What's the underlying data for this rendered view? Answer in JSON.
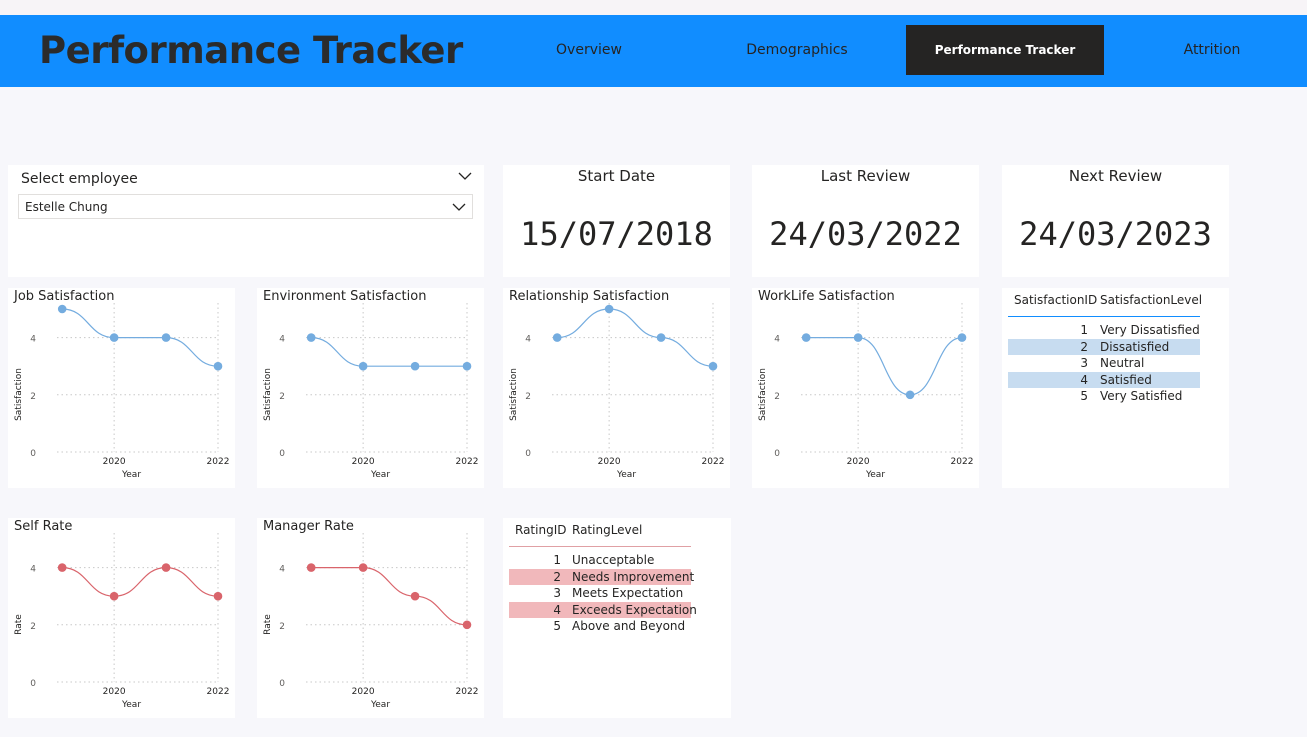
{
  "header": {
    "title": "Performance Tracker",
    "tabs": [
      {
        "label": "Overview",
        "active": false
      },
      {
        "label": "Demographics",
        "active": false
      },
      {
        "label": "Performance Tracker",
        "active": true
      },
      {
        "label": "Attrition",
        "active": false
      }
    ],
    "accent_color": "#118dff",
    "active_tab_color": "#252423"
  },
  "slicer": {
    "label": "Select employee",
    "selected": "Estelle Chung"
  },
  "dates": {
    "start": {
      "title": "Start Date",
      "value": "15/07/2018"
    },
    "last_review": {
      "title": "Last Review",
      "value": "24/03/2022"
    },
    "next_review": {
      "title": "Next Review",
      "value": "24/03/2023"
    }
  },
  "satisfaction_table": {
    "headers": [
      "SatisfactionID",
      "SatisfactionLevel"
    ],
    "rows": [
      {
        "id": "1",
        "level": "Very Dissatisfied",
        "highlight": false
      },
      {
        "id": "2",
        "level": "Dissatisfied",
        "highlight": true
      },
      {
        "id": "3",
        "level": "Neutral",
        "highlight": false
      },
      {
        "id": "4",
        "level": "Satisfied",
        "highlight": true
      },
      {
        "id": "5",
        "level": "Very Satisfied",
        "highlight": false
      }
    ],
    "highlight_color": "#c7dcf0",
    "rule_color": "#118dff"
  },
  "rating_table": {
    "headers": [
      "RatingID",
      "RatingLevel"
    ],
    "rows": [
      {
        "id": "1",
        "level": "Unacceptable",
        "highlight": false
      },
      {
        "id": "2",
        "level": "Needs Improvement",
        "highlight": true
      },
      {
        "id": "3",
        "level": "Meets Expectation",
        "highlight": false
      },
      {
        "id": "4",
        "level": "Exceeds Expectation",
        "highlight": true
      },
      {
        "id": "5",
        "level": "Above and Beyond",
        "highlight": false
      }
    ],
    "highlight_color": "#f1b8bb",
    "rule_color": "#e0a0a4"
  },
  "chart_data": [
    {
      "id": "job",
      "type": "line",
      "title": "Job Satisfaction",
      "xlabel": "Year",
      "ylabel": "Satisfaction",
      "x": [
        2019,
        2020,
        2021,
        2022
      ],
      "x_ticks": [
        "2020",
        "2022"
      ],
      "y_ticks": [
        "0",
        "2",
        "4"
      ],
      "ylim": [
        0,
        5
      ],
      "values": [
        5,
        4,
        4,
        3
      ],
      "color": "#74acdf"
    },
    {
      "id": "env",
      "type": "line",
      "title": "Environment Satisfaction",
      "xlabel": "Year",
      "ylabel": "Satisfaction",
      "x": [
        2019,
        2020,
        2021,
        2022
      ],
      "x_ticks": [
        "2020",
        "2022"
      ],
      "y_ticks": [
        "0",
        "2",
        "4"
      ],
      "ylim": [
        0,
        5
      ],
      "values": [
        4,
        3,
        3,
        3
      ],
      "color": "#74acdf"
    },
    {
      "id": "rel",
      "type": "line",
      "title": "Relationship Satisfaction",
      "xlabel": "Year",
      "ylabel": "Satisfaction",
      "x": [
        2019,
        2020,
        2021,
        2022
      ],
      "x_ticks": [
        "2020",
        "2022"
      ],
      "y_ticks": [
        "0",
        "2",
        "4"
      ],
      "ylim": [
        0,
        5
      ],
      "values": [
        4,
        5,
        4,
        3
      ],
      "color": "#74acdf"
    },
    {
      "id": "wl",
      "type": "line",
      "title": "WorkLife Satisfaction",
      "xlabel": "Year",
      "ylabel": "Satisfaction",
      "x": [
        2019,
        2020,
        2021,
        2022
      ],
      "x_ticks": [
        "2020",
        "2022"
      ],
      "y_ticks": [
        "0",
        "2",
        "4"
      ],
      "ylim": [
        0,
        5
      ],
      "values": [
        4,
        4,
        2,
        4
      ],
      "color": "#74acdf"
    },
    {
      "id": "self",
      "type": "line",
      "title": "Self Rate",
      "xlabel": "Year",
      "ylabel": "Rate",
      "x": [
        2019,
        2020,
        2021,
        2022
      ],
      "x_ticks": [
        "2020",
        "2022"
      ],
      "y_ticks": [
        "0",
        "2",
        "4"
      ],
      "ylim": [
        0,
        5
      ],
      "values": [
        4,
        3,
        4,
        3
      ],
      "color": "#d9646b"
    },
    {
      "id": "mgr",
      "type": "line",
      "title": "Manager Rate",
      "xlabel": "Year",
      "ylabel": "Rate",
      "x": [
        2019,
        2020,
        2021,
        2022
      ],
      "x_ticks": [
        "2020",
        "2022"
      ],
      "y_ticks": [
        "0",
        "2",
        "4"
      ],
      "ylim": [
        0,
        5
      ],
      "values": [
        4,
        4,
        3,
        2
      ],
      "color": "#d9646b"
    }
  ]
}
